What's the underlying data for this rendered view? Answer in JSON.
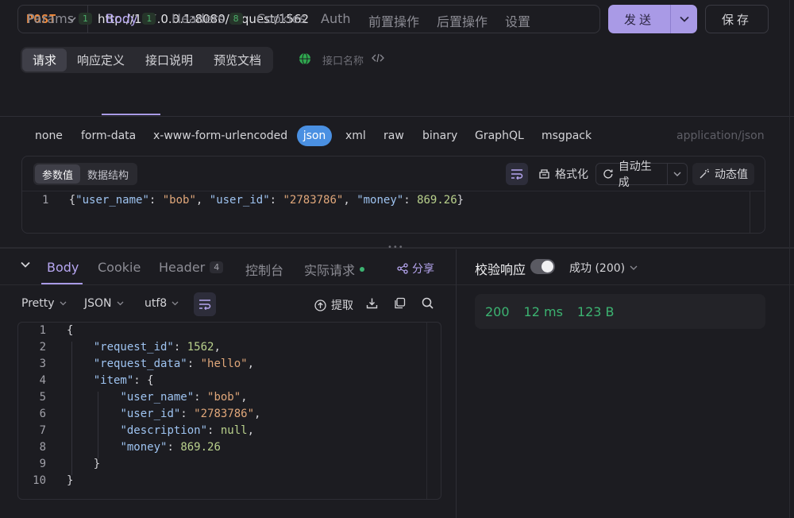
{
  "request": {
    "method": "POST",
    "url": "http://127.0.0.1:8080/request/1562",
    "send_label": "发送",
    "save_label": "保存"
  },
  "doc_tabs": [
    "请求",
    "响应定义",
    "接口说明",
    "预览文档"
  ],
  "api_name_placeholder": "接口名称",
  "request_tabs": [
    {
      "label": "Params",
      "badge": "1"
    },
    {
      "label": "Body",
      "badge": "1"
    },
    {
      "label": "Headers",
      "badge": "8"
    },
    {
      "label": "Cookies"
    },
    {
      "label": "Auth"
    },
    {
      "label": "前置操作"
    },
    {
      "label": "后置操作"
    },
    {
      "label": "设置"
    }
  ],
  "body_types": [
    "none",
    "form-data",
    "x-www-form-urlencoded",
    "json",
    "xml",
    "raw",
    "binary",
    "GraphQL",
    "msgpack"
  ],
  "content_type": "application/json",
  "editor": {
    "sub_tabs": [
      "参数值",
      "数据结构"
    ],
    "format_label": "格式化",
    "autogen_label": "自动生成",
    "dynamic_label": "动态值",
    "line_no": "1"
  },
  "response": {
    "tabs": [
      {
        "label": "Body"
      },
      {
        "label": "Cookie"
      },
      {
        "label": "Header",
        "badge": "4"
      },
      {
        "label": "控制台"
      },
      {
        "label": "实际请求"
      }
    ],
    "share_label": "分享",
    "view_mode": "Pretty",
    "format": "JSON",
    "encoding": "utf8",
    "extract_label": "提取",
    "line_numbers": "1\n2\n3\n4\n5\n6\n7\n8\n9\n10"
  },
  "verify": {
    "label": "校验响应",
    "status": "成功 (200)",
    "code": "200",
    "time": "12 ms",
    "size": "123 B"
  },
  "colors": {
    "accent": "#a99ae6",
    "method": "#f08a3c",
    "success": "#3cb371",
    "json_pill": "#4a90e2"
  }
}
